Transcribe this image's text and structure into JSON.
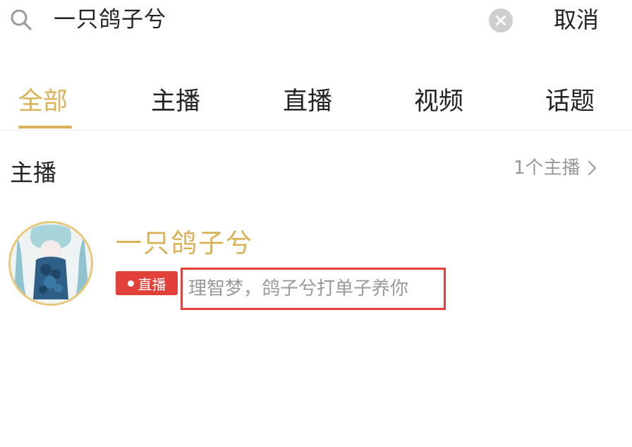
{
  "search": {
    "query": "一只鸽子兮",
    "cancel_label": "取消"
  },
  "tabs": [
    {
      "label": "全部",
      "active": true
    },
    {
      "label": "主播",
      "active": false
    },
    {
      "label": "直播",
      "active": false
    },
    {
      "label": "视频",
      "active": false
    },
    {
      "label": "话题",
      "active": false
    }
  ],
  "section": {
    "title": "主播",
    "more_label": "1个主播"
  },
  "results": [
    {
      "name": "一只鸽子兮",
      "badge": "直播",
      "stream_title": "理智梦，鸽子兮打单子养你"
    }
  ],
  "colors": {
    "accent": "#d9b257",
    "live_badge": "#e2403a",
    "highlight_box": "#e2403a"
  },
  "icons": {
    "search": "search-icon",
    "clear": "clear-icon",
    "more": "chevron-right-icon",
    "live": "live-dot-icon"
  }
}
